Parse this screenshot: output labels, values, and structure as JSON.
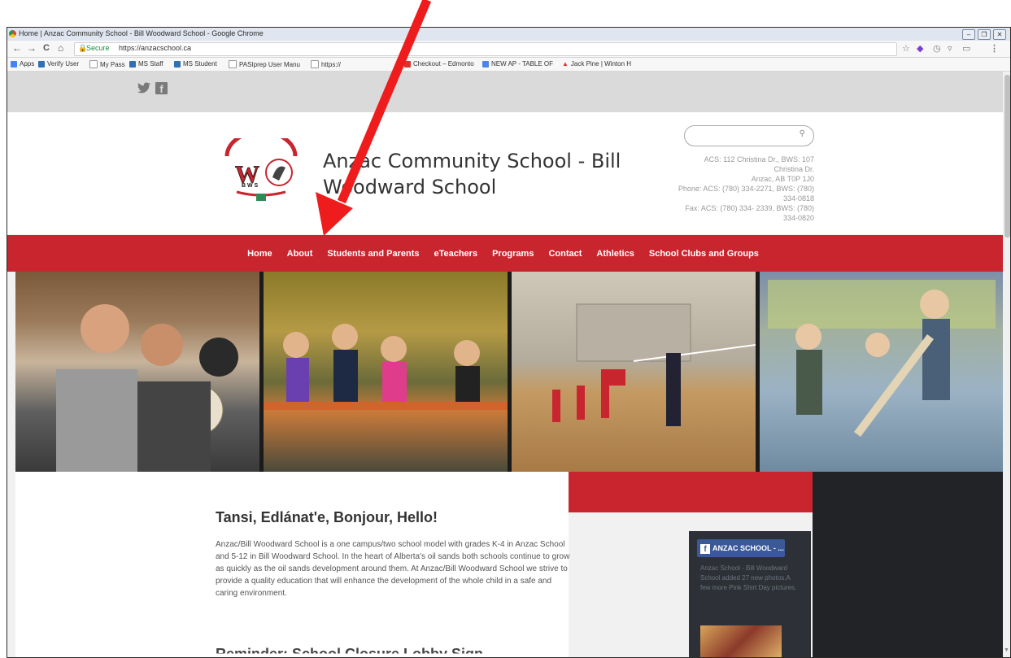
{
  "window": {
    "title": "Home | Anzac Community School - Bill Woodward School - Google Chrome",
    "minimize_glyph": "–",
    "maximize_glyph": "❐",
    "close_glyph": "✕"
  },
  "toolbar": {
    "back_glyph": "←",
    "forward_glyph": "→",
    "reload_glyph": "C",
    "home_glyph": "⌂",
    "secure_label": "Secure",
    "url": "https://anzacschool.ca",
    "star_glyph": "☆",
    "menu_glyph": "⋮"
  },
  "bookmarks": [
    {
      "label": "Apps",
      "icon": "apps-grid-icon",
      "color": "#4285f4"
    },
    {
      "label": "Verify User",
      "icon": "ms-icon",
      "color": "#2f6fb5"
    },
    {
      "label": "My Pass",
      "icon": "page-icon",
      "color": "#ffffff"
    },
    {
      "label": "MS Staff",
      "icon": "ms-icon",
      "color": "#2f6fb5"
    },
    {
      "label": "MS Student",
      "icon": "ms-icon",
      "color": "#2f6fb5"
    },
    {
      "label": "PASIprep User Manu",
      "icon": "page-icon",
      "color": "#ffffff"
    },
    {
      "label": "https://",
      "icon": "page-icon",
      "color": "#ffffff"
    },
    {
      "label": "Checkout – Edmonto",
      "icon": "checkout-icon",
      "color": "#d9342b"
    },
    {
      "label": "NEW AP - TABLE OF",
      "icon": "doc-icon",
      "color": "#4a86e8"
    },
    {
      "label": "Jack Pine | Winton H",
      "icon": "pine-icon",
      "color": "#d9342b"
    }
  ],
  "social": {
    "twitter_glyph": "🐦",
    "facebook_glyph": "f"
  },
  "site": {
    "title": "Anzac Community School - Bill Woodward School",
    "search_placeholder": "",
    "search_glyph": "⚲",
    "address": [
      "ACS: 112 Christina Dr., BWS: 107",
      "Christina Dr.",
      "Anzac, AB T0P 1J0",
      "Phone: ACS: (780) 334-2271, BWS: (780)",
      "334-0818",
      "Fax: ACS: (780) 334- 2339, BWS: (780)",
      "334-0820"
    ]
  },
  "nav": [
    "Home",
    "About",
    "Students and Parents",
    "eTeachers",
    "Programs",
    "Contact",
    "Athletics",
    "School Clubs and Groups"
  ],
  "content": {
    "heading": "Tansi, Edlánat'e, Bonjour, Hello!",
    "intro": "Anzac/Bill Woodward School is a one campus/two school model with grades K-4 in Anzac School and 5-12 in Bill Woodward School. In the heart of Alberta's oil sands both schools continue to grow as quickly as the oil sands development around them. At Anzac/Bill Woodward School we strive to provide a quality education that will enhance the development of the whole child in a safe and caring environment.",
    "next_heading": "Reminder: School Closure Lobby Sign"
  },
  "widget": {
    "fb_label": "ANZAC SCHOOL - ...",
    "text": "Anzac School - Bill Woodward School added 27 new photos.A few more Pink Shirt Day pictures."
  },
  "colors": {
    "brand_red": "#c9252f",
    "annotation_arrow": "#ee1c1c"
  }
}
